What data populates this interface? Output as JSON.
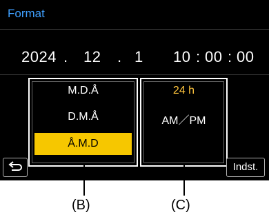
{
  "header": {
    "title": "Format"
  },
  "datetime": {
    "year": "2024",
    "sep1": ".",
    "month": "12",
    "sep2": ".",
    "day": "1",
    "hour": "10",
    "colon1": ":",
    "minute": "00",
    "colon2": ":",
    "second": "00"
  },
  "date_order_panel": {
    "options": [
      "M.D.Å",
      "D.M.Å",
      "Å.M.D"
    ],
    "selected": "Å.M.D"
  },
  "time_format_panel": {
    "options": [
      "24 h",
      "AM／PM"
    ],
    "current": "24 h"
  },
  "footer": {
    "back_icon": "return-arrow-icon",
    "set_label": "Indst."
  },
  "callouts": {
    "b": "(B)",
    "c": "(C)"
  },
  "colors": {
    "title": "#3fa0ff",
    "selection": "#f6c700",
    "current": "#ffc53d"
  }
}
